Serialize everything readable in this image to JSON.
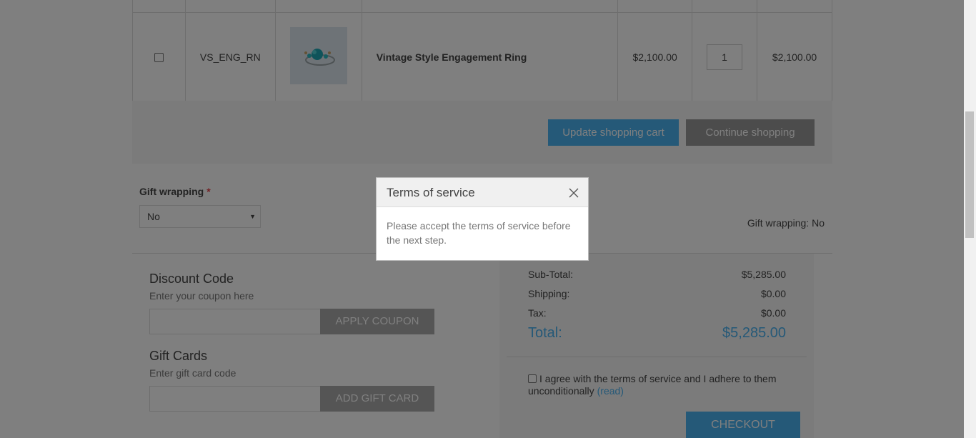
{
  "cart": {
    "item": {
      "sku": "VS_ENG_RN",
      "name": "Vintage Style Engagement Ring",
      "price": "$2,100.00",
      "quantity": "1",
      "total": "$2,100.00"
    },
    "update_label": "Update shopping cart",
    "continue_label": "Continue shopping"
  },
  "gift_wrapping": {
    "label": "Gift wrapping",
    "required_mark": "*",
    "selected": "No",
    "summary": "Gift wrapping: No"
  },
  "discount": {
    "title": "Discount Code",
    "hint": "Enter your coupon here",
    "button": "APPLY COUPON"
  },
  "gift_cards": {
    "title": "Gift Cards",
    "hint": "Enter gift card code",
    "button": "ADD GIFT CARD"
  },
  "totals": {
    "subtotal_label": "Sub-Total:",
    "subtotal_value": "$5,285.00",
    "shipping_label": "Shipping:",
    "shipping_value": "$0.00",
    "tax_label": "Tax:",
    "tax_value": "$0.00",
    "total_label": "Total:",
    "total_value": "$5,285.00",
    "terms_text": "I agree with the terms of service and I adhere to them unconditionally",
    "terms_link": "(read)",
    "checkout_label": "CHECKOUT"
  },
  "modal": {
    "title": "Terms of service",
    "body": "Please accept the terms of service before the next step."
  },
  "colors": {
    "accent": "#4ab2f1",
    "required": "#e4434b",
    "secondary_button": "#999999"
  }
}
